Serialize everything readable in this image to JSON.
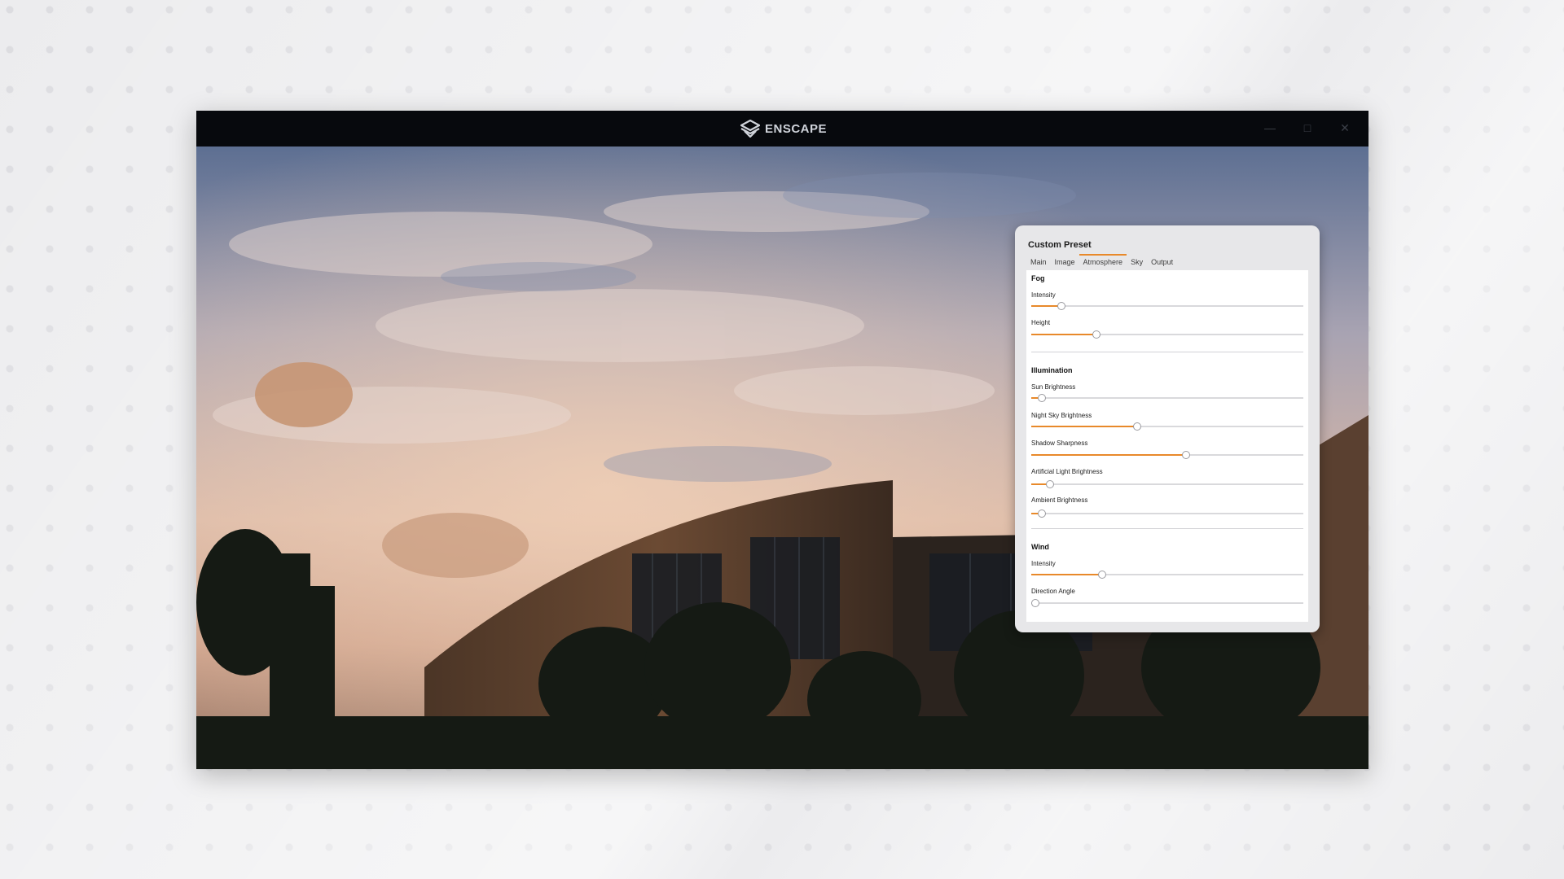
{
  "app": {
    "brand": "ENSCAPE"
  },
  "panel": {
    "title": "Custom Preset",
    "tabs": [
      {
        "label": "Main",
        "active": false
      },
      {
        "label": "Image",
        "active": false
      },
      {
        "label": "Atmosphere",
        "active": true
      },
      {
        "label": "Sky",
        "active": false
      },
      {
        "label": "Output",
        "active": false
      }
    ],
    "sections": {
      "fog": {
        "title": "Fog",
        "sliders": [
          {
            "label": "Intensity",
            "value": 0.11
          },
          {
            "label": "Height",
            "value": 0.24
          }
        ]
      },
      "illumination": {
        "title": "Illumination",
        "sliders": [
          {
            "label": "Sun Brightness",
            "value": 0.04
          },
          {
            "label": "Night Sky Brightness",
            "value": 0.39
          },
          {
            "label": "Shadow Sharpness",
            "value": 0.57
          },
          {
            "label": "Artificial Light Brightness",
            "value": 0.07
          },
          {
            "label": "Ambient Brightness",
            "value": 0.04
          }
        ]
      },
      "wind": {
        "title": "Wind",
        "sliders": [
          {
            "label": "Intensity",
            "value": 0.26
          },
          {
            "label": "Direction Angle",
            "value": 0.0
          }
        ]
      }
    }
  },
  "colors": {
    "accent": "#e8892a",
    "titlebar": "#07090d",
    "panel_bg": "#e7e7e9"
  },
  "icons": {
    "brand": "enscape-logo-icon",
    "minimize": "minimize-icon",
    "maximize": "maximize-icon",
    "close": "close-icon"
  }
}
